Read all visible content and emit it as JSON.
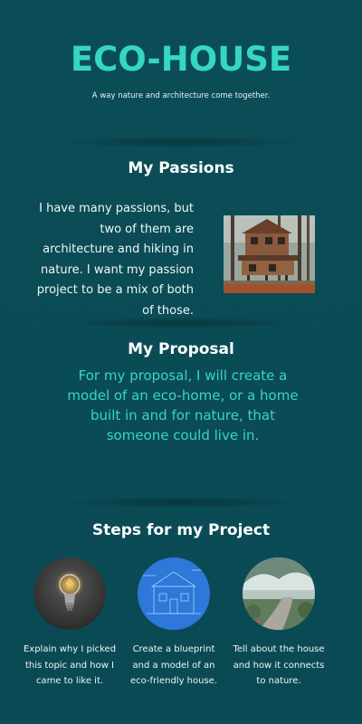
{
  "header": {
    "title": "ECO-HOUSE",
    "subtitle": "A way nature and architecture come together."
  },
  "passions": {
    "heading": "My Passions",
    "text": "I have many passions, but two of them are architecture and hiking in nature. I want my passion project to be a mix of both of those.",
    "image_icon": "treehouse-photo"
  },
  "proposal": {
    "heading": "My Proposal",
    "text": "For my proposal, I will create a model of an eco-home, or a home built in and for nature, that someone could live in."
  },
  "steps": {
    "heading": "Steps for my Project",
    "items": [
      {
        "icon": "lightbulb-icon",
        "text": "Explain why I picked this topic and how I came to like it."
      },
      {
        "icon": "blueprint-icon",
        "text": "Create a blueprint and a model of an eco-friendly house."
      },
      {
        "icon": "nature-path-icon",
        "text": "Tell about the house and how it connects to nature."
      }
    ]
  },
  "colors": {
    "background": "#0b4d57",
    "accent": "#37d6c3",
    "text": "#ffffff"
  }
}
